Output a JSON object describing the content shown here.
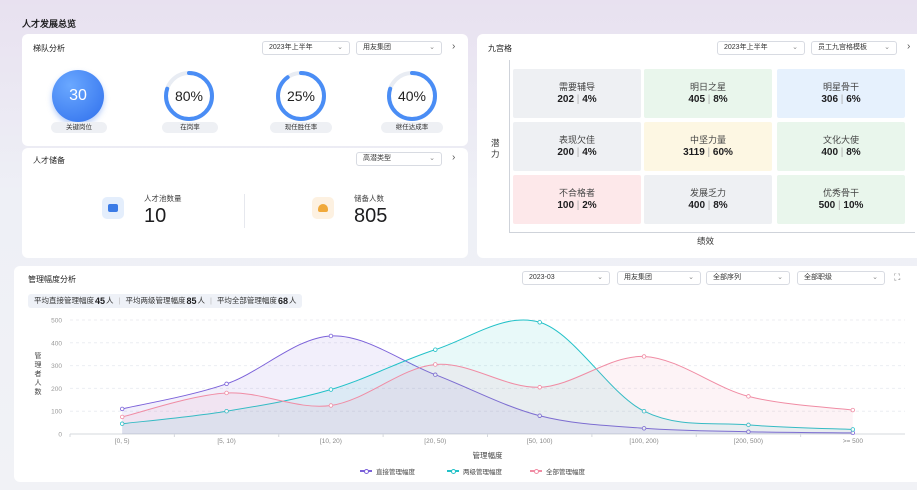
{
  "page_title": "人才发展总览",
  "ladder": {
    "title": "梯队分析",
    "period": "2023年上半年",
    "org": "用友集团",
    "metrics": [
      {
        "value": "30",
        "label": "关键岗位"
      },
      {
        "value": "80%",
        "label": "在岗率",
        "ratio": 0.8
      },
      {
        "value": "25%",
        "label": "现任胜任率",
        "ratio": 0.9
      },
      {
        "value": "40%",
        "label": "继任达成率",
        "ratio": 0.8
      }
    ]
  },
  "reserve": {
    "title": "人才储备",
    "type_select": "高潜类型",
    "pool_label": "人才池数量",
    "pool_value": "10",
    "reserve_label": "储备人数",
    "reserve_value": "805"
  },
  "nine_grid": {
    "title": "九宫格",
    "period": "2023年上半年",
    "template": "员工九宫格模板",
    "y_axis": "潜力",
    "x_axis": "绩效",
    "cells": [
      {
        "name": "需要辅导",
        "count": "202",
        "pct": "4%",
        "bg": "#eef0f3"
      },
      {
        "name": "明日之星",
        "count": "405",
        "pct": "8%",
        "bg": "#e9f6ec"
      },
      {
        "name": "明星骨干",
        "count": "306",
        "pct": "6%",
        "bg": "#e6f1fd"
      },
      {
        "name": "表现欠佳",
        "count": "200",
        "pct": "4%",
        "bg": "#eef0f3"
      },
      {
        "name": "中坚力量",
        "count": "3119",
        "pct": "60%",
        "bg": "#fdf7e3"
      },
      {
        "name": "文化大使",
        "count": "400",
        "pct": "8%",
        "bg": "#e9f6ec"
      },
      {
        "name": "不合格者",
        "count": "100",
        "pct": "2%",
        "bg": "#fde8ea"
      },
      {
        "name": "发展乏力",
        "count": "400",
        "pct": "8%",
        "bg": "#eef0f3"
      },
      {
        "name": "优秀骨干",
        "count": "500",
        "pct": "10%",
        "bg": "#e9f6ec"
      }
    ]
  },
  "span": {
    "title": "管理幅度分析",
    "month": "2023-03",
    "org": "用友集团",
    "sequence": "全部序列",
    "level": "全部职级",
    "summary": [
      {
        "label": "平均直接管理幅度",
        "value": "45",
        "unit": "人"
      },
      {
        "label": "平均两级管理幅度",
        "value": "85",
        "unit": "人"
      },
      {
        "label": "平均全部管理幅度",
        "value": "68",
        "unit": "人"
      }
    ]
  },
  "chart_data": {
    "type": "line",
    "xlabel": "管理幅度",
    "ylabel": "管理者人数",
    "ylim": [
      0,
      500
    ],
    "yticks": [
      0,
      100,
      200,
      300,
      400,
      500
    ],
    "categories": [
      "[0, 5)",
      "[5, 10)",
      "[10, 20)",
      "[20, 50)",
      "[50, 100)",
      "[100, 200)",
      "[200, 500)",
      ">= 500"
    ],
    "series": [
      {
        "name": "直接管理幅度",
        "color": "#7b61d9",
        "values": [
          110,
          220,
          430,
          260,
          80,
          25,
          10,
          5
        ]
      },
      {
        "name": "两级管理幅度",
        "color": "#22c1c8",
        "values": [
          45,
          100,
          195,
          370,
          490,
          100,
          40,
          20
        ]
      },
      {
        "name": "全部管理幅度",
        "color": "#f08ca4",
        "values": [
          75,
          180,
          125,
          305,
          205,
          340,
          165,
          105
        ]
      }
    ],
    "grid": true,
    "legend": "bottom"
  }
}
